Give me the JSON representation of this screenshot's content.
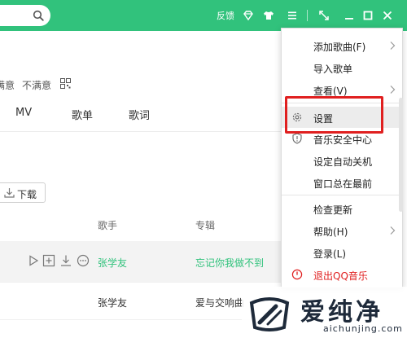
{
  "colors": {
    "brand": "#31c27c",
    "menu_accent": "#e02020",
    "highlight": "#e02020"
  },
  "titlebar": {
    "search_icon": "search-icon",
    "feedback_label": "反馈",
    "icons": [
      "diamond-icon",
      "skin-icon",
      "menu-icon",
      "mini-mode-icon",
      "minimize-icon",
      "maximize-icon",
      "close-icon"
    ]
  },
  "song": {
    "rating_good": "满意",
    "rating_bad": "不满意",
    "tabs": [
      "MV",
      "歌单",
      "歌词"
    ],
    "download_label": "下载",
    "columns": {
      "artist": "歌手",
      "album": "专辑"
    },
    "rows": [
      {
        "artist": "张学友",
        "album": "忘记你我做不到"
      },
      {
        "artist": "张学友",
        "album": "爱与交响曲"
      }
    ]
  },
  "menu": {
    "items": [
      {
        "label": "添加歌曲(F)",
        "arrow": true
      },
      {
        "label": "导入歌单"
      },
      {
        "label": "查看(V)",
        "arrow": true
      },
      {
        "label": "设置",
        "icon": "gear-icon"
      },
      {
        "label": "音乐安全中心",
        "icon": "shield-icon"
      },
      {
        "label": "设定自动关机"
      },
      {
        "label": "窗口总在最前"
      },
      {
        "label": "检查更新"
      },
      {
        "label": "帮助(H)",
        "arrow": true
      },
      {
        "label": "登录(L)"
      },
      {
        "label": "退出QQ音乐",
        "icon": "power-icon"
      }
    ]
  },
  "watermark": {
    "title": "爱纯净",
    "url": "aichunjing.com"
  }
}
